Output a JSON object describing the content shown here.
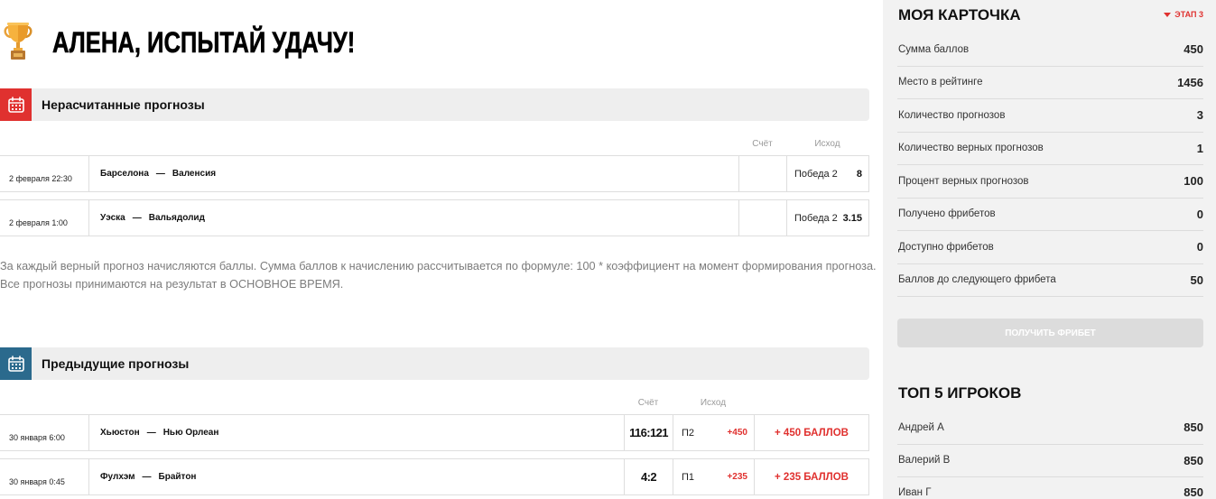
{
  "page": {
    "title": "АЛЕНА, ИСПЫТАЙ УДАЧУ!"
  },
  "match_separator": "—",
  "pending": {
    "heading": "Нерасчитанные прогнозы",
    "col_score": "Счёт",
    "col_outcome": "Исход",
    "rows": [
      {
        "date": "2 февраля 22:30",
        "home": "Барселона",
        "away": "Валенсия",
        "outcome": "Победа 2",
        "coef": "8"
      },
      {
        "date": "2 февраля 1:00",
        "home": "Уэска",
        "away": "Вальядолид",
        "outcome": "Победа 2",
        "coef": "3.15"
      }
    ]
  },
  "info": {
    "line1": "За каждый верный прогноз начисляются баллы. Сумма баллов к начислению рассчитывается по формуле: 100 * коэффициент на момент формирования прогноза.",
    "line2": "Все прогнозы принимаются на результат в ОСНОВНОЕ ВРЕМЯ."
  },
  "previous": {
    "heading": "Предыдущие прогнозы",
    "col_score": "Счёт",
    "col_outcome": "Исход",
    "rows": [
      {
        "date": "30 января 6:00",
        "home": "Хьюстон",
        "away": "Нью Орлеан",
        "score": "116:121",
        "outcome": "П2",
        "delta": "+450",
        "points": "+ 450 БАЛЛОВ"
      },
      {
        "date": "30 января 0:45",
        "home": "Фулхэм",
        "away": "Брайтон",
        "score": "4:2",
        "outcome": "П1",
        "delta": "+235",
        "points": "+ 235 БАЛЛОВ"
      }
    ]
  },
  "card": {
    "title": "МОЯ КАРТОЧКА",
    "stage": "ЭТАП 3",
    "stats": [
      {
        "label": "Сумма баллов",
        "value": "450"
      },
      {
        "label": "Место в рейтинге",
        "value": "1456"
      },
      {
        "label": "Количество прогнозов",
        "value": "3"
      },
      {
        "label": "Количество верных прогнозов",
        "value": "1"
      },
      {
        "label": "Процент верных прогнозов",
        "value": "100"
      },
      {
        "label": "Получено фрибетов",
        "value": "0"
      },
      {
        "label": "Доступно фрибетов",
        "value": "0"
      },
      {
        "label": "Баллов до следующего фрибета",
        "value": "50"
      }
    ],
    "button": "ПОЛУЧИТЬ ФРИБЕТ"
  },
  "top": {
    "title": "ТОП 5 ИГРОКОВ",
    "players": [
      {
        "name": "Андрей А",
        "score": "850"
      },
      {
        "name": "Валерий В",
        "score": "850"
      },
      {
        "name": "Иван Г",
        "score": "850"
      }
    ]
  },
  "icons": {
    "trophy": "trophy-icon",
    "calendar": "calendar-icon",
    "caret": "caret-down-icon"
  },
  "colors": {
    "accent_red": "#e0312f",
    "section_blue": "#2b6a8d",
    "sidebar_bg": "#f2f2f2",
    "header_bar_bg": "#eeeeee",
    "button_disabled_bg": "#dcdcdc"
  }
}
